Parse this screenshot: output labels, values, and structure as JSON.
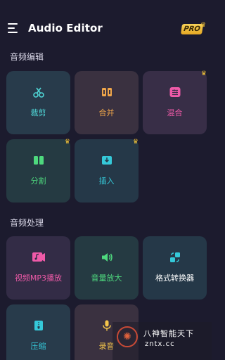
{
  "header": {
    "title": "Audio Editor",
    "badge": "PRO"
  },
  "sections": {
    "edit": {
      "title": "音频编辑",
      "items": [
        {
          "label": "裁剪",
          "icon": "scissors-icon",
          "premium": false
        },
        {
          "label": "合并",
          "icon": "merge-icon",
          "premium": false
        },
        {
          "label": "混合",
          "icon": "mix-sliders-icon",
          "premium": true
        },
        {
          "label": "分割",
          "icon": "split-icon",
          "premium": true
        },
        {
          "label": "插入",
          "icon": "insert-icon",
          "premium": true
        }
      ]
    },
    "process": {
      "title": "音频处理",
      "items": [
        {
          "label": "视频MP3播放",
          "icon": "video-music-icon",
          "premium": false
        },
        {
          "label": "音量放大",
          "icon": "volume-icon",
          "premium": false
        },
        {
          "label": "格式转换器",
          "icon": "convert-icon",
          "premium": false
        },
        {
          "label": "压缩",
          "icon": "compress-icon",
          "premium": false
        },
        {
          "label": "录音",
          "icon": "microphone-icon",
          "premium": false
        }
      ]
    }
  },
  "watermark": {
    "line1": "八神智能天下",
    "line2": "zntx.cc"
  },
  "colors": {
    "background": "#1c1b2e",
    "teal": "#4fd6d6",
    "orange": "#f0a64a",
    "pink": "#ef5aa8",
    "green": "#4ed97e",
    "cyan": "#35c9d9",
    "yellow": "#f5c64b",
    "crown": "#f3c437"
  }
}
